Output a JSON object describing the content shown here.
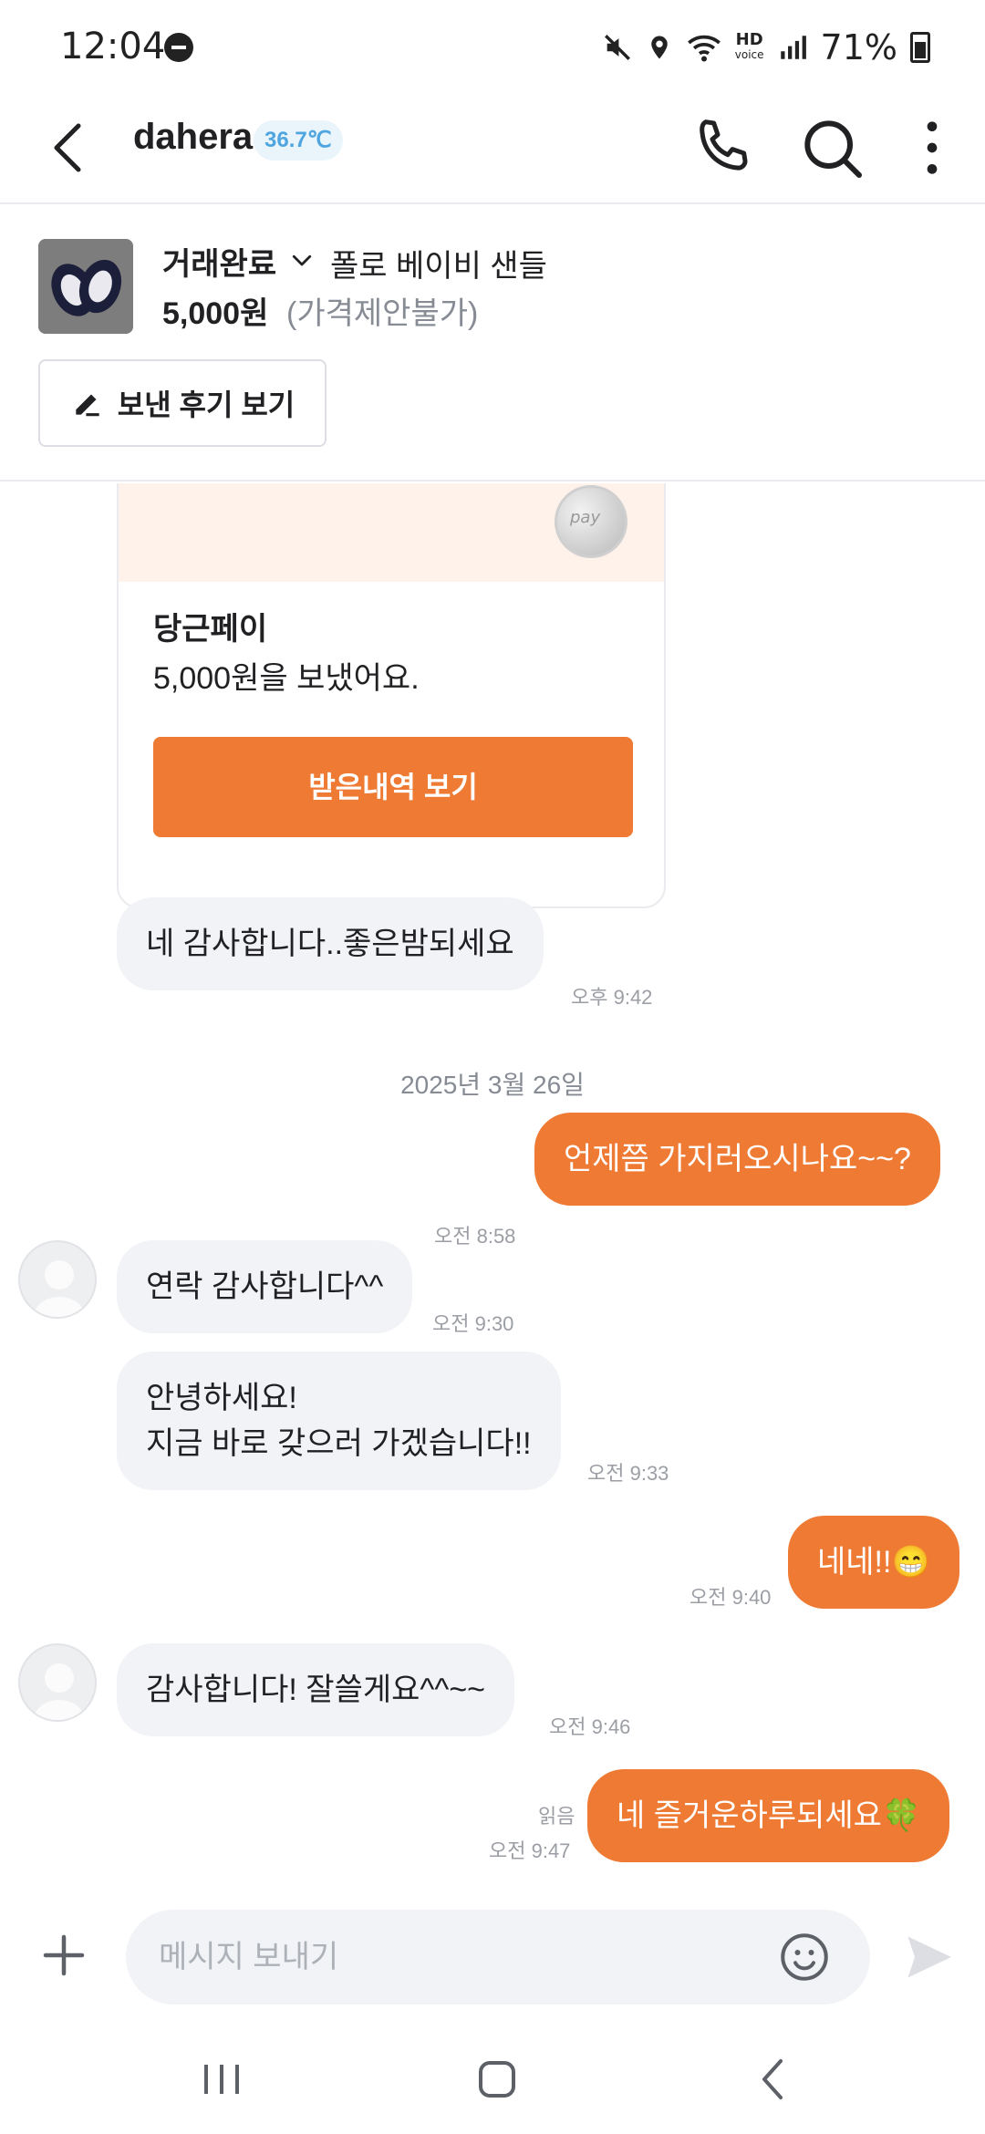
{
  "status_bar": {
    "time": "12:04",
    "battery": "71%",
    "hd_top": "HD",
    "hd_bottom": "voice"
  },
  "header": {
    "name": "dahera",
    "temperature": "36.7℃",
    "icons": [
      "back-arrow-icon",
      "phone-icon",
      "search-icon",
      "more-vertical-icon"
    ]
  },
  "product": {
    "status": "거래완료",
    "title": "폴로 베이비 샌들",
    "price": "5,000원",
    "price_note": "(가격제안불가)",
    "review_button": "보낸 후기 보기"
  },
  "pay_card": {
    "coin_text": "pay",
    "title": "당근페이",
    "description": "5,000원을 보냈어요.",
    "button": "받은내역 보기"
  },
  "messages": [
    {
      "side": "in",
      "text": "네 감사합니다..좋은밤되세요",
      "time": "오후 9:42"
    },
    {
      "side": "out",
      "text": "언제쯤 가지러오시나요~~?",
      "time": "오전 8:58"
    },
    {
      "side": "in",
      "text": "연락 감사합니다^^",
      "time": "오전 9:30"
    },
    {
      "side": "in",
      "text_line1": "안녕하세요!",
      "text_line2": "지금 바로 갖으러 가겠습니다!!",
      "time": "오전 9:33"
    },
    {
      "side": "out",
      "text": "네네!!😁",
      "time": "오전 9:40"
    },
    {
      "side": "in",
      "text": "감사합니다! 잘쓸게요^^~~",
      "time": "오전 9:46"
    },
    {
      "side": "out",
      "text": "네 즐거운하루되세요🍀",
      "time": "오전 9:47",
      "read": "읽음"
    }
  ],
  "date_separator": "2025년 3월 26일",
  "input": {
    "placeholder": "메시지 보내기"
  },
  "colors": {
    "accent": "#ee7a33",
    "incoming_bubble": "#f2f3f6",
    "temperature_badge": "#4fa5e0"
  }
}
